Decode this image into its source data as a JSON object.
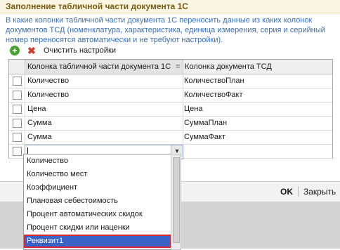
{
  "form": {
    "title": "Заполнение табличной части документа 1С",
    "description": "В какие колонки табличной части документа 1С переносить данные из каких колонок документов ТСД (номенклатура, характеристика, единица измерения, серия и серийный номер переносятся автоматически и не требуют настройки)."
  },
  "toolbar": {
    "add_icon": "+",
    "delete_icon": "✖",
    "clear_label": "Очистить настройки"
  },
  "table": {
    "columns": [
      "Колонка табличной части документа 1С",
      "Колонка документа ТСД"
    ],
    "sort_indicator": "=",
    "rows": [
      {
        "col1": "Количество",
        "col2": "КоличествоПлан"
      },
      {
        "col1": "Количество",
        "col2": "КоличествоФакт"
      },
      {
        "col1": "Цена",
        "col2": "Цена"
      },
      {
        "col1": "Сумма",
        "col2": "СуммаПлан"
      },
      {
        "col1": "Сумма",
        "col2": "СуммаФакт"
      }
    ],
    "edit_row": {
      "col1": "",
      "col2": "",
      "dropdown_icon": "▼"
    }
  },
  "dropdown": {
    "items": [
      "Количество",
      "Количество мест",
      "Коэффициент",
      "Плановая себестоимость",
      "Процент автоматических скидок",
      "Процент скидки или наценки",
      "Реквизит1"
    ],
    "selected": "Реквизит1"
  },
  "buttons": {
    "ok": "OK",
    "close": "Закрыть"
  }
}
